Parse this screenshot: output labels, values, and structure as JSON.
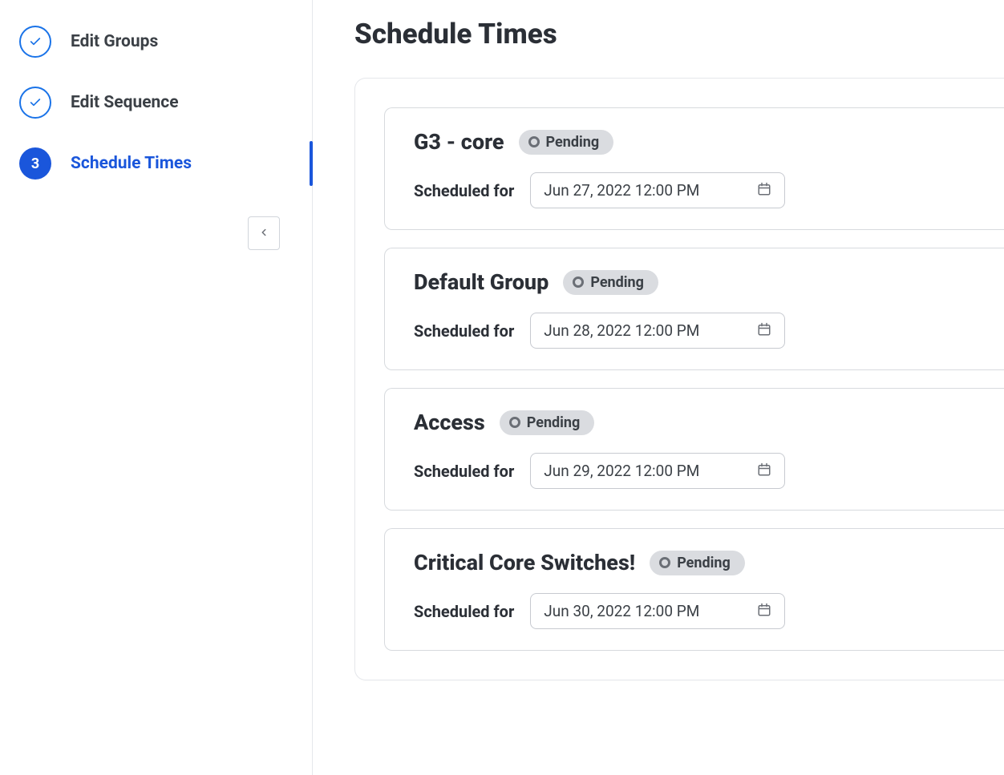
{
  "sidebar": {
    "steps": [
      {
        "label": "Edit Groups",
        "state": "done"
      },
      {
        "label": "Edit Sequence",
        "state": "done"
      },
      {
        "label": "Schedule Times",
        "state": "active",
        "number": "3"
      }
    ]
  },
  "main": {
    "title": "Schedule Times",
    "schedule_label": "Scheduled for",
    "groups": [
      {
        "name": "G3 - core",
        "status": "Pending",
        "datetime": "Jun 27, 2022 12:00 PM"
      },
      {
        "name": "Default Group",
        "status": "Pending",
        "datetime": "Jun 28, 2022 12:00 PM"
      },
      {
        "name": "Access",
        "status": "Pending",
        "datetime": "Jun 29, 2022 12:00 PM"
      },
      {
        "name": "Critical Core Switches!",
        "status": "Pending",
        "datetime": "Jun 30, 2022 12:00 PM"
      }
    ]
  }
}
